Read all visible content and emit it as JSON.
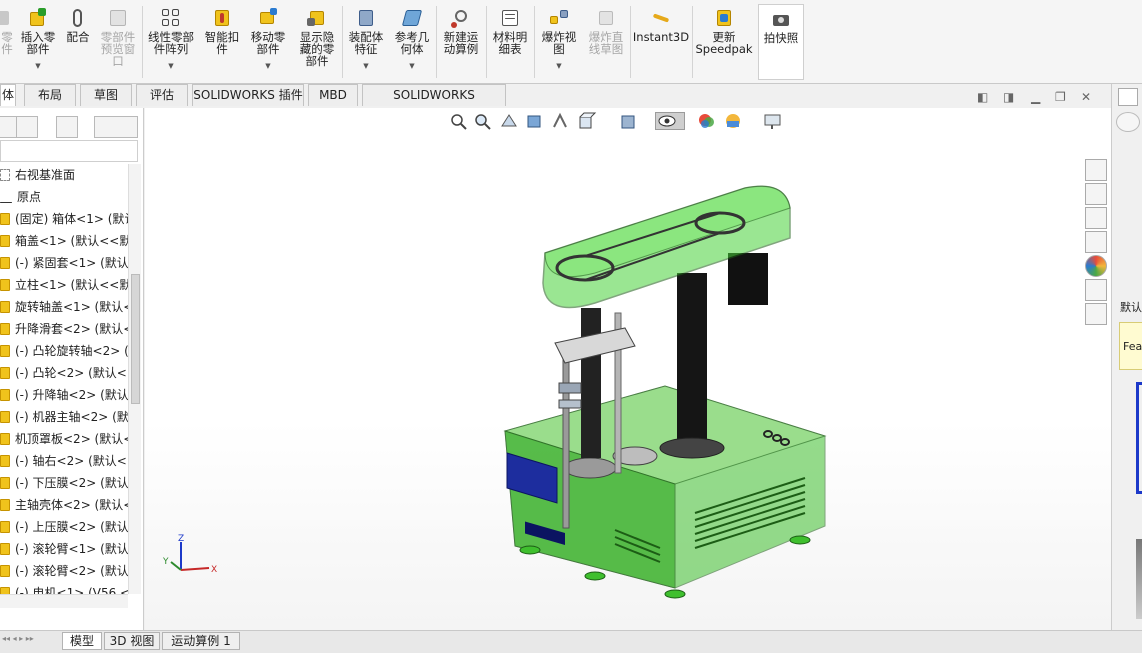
{
  "ribbon": {
    "items": [
      {
        "label": "零\n件",
        "disabled": true
      },
      {
        "label": "插入零\n部件",
        "dropdown": true
      },
      {
        "label": "配合"
      },
      {
        "label": "零部件\n预览窗\n口",
        "disabled": true
      },
      {
        "label": "线性零部\n件阵列",
        "dropdown": true
      },
      {
        "label": "智能扣\n件"
      },
      {
        "label": "移动零\n部件",
        "dropdown": true
      },
      {
        "label": "显示隐\n藏的零\n部件"
      },
      {
        "label": "装配体\n特征",
        "dropdown": true
      },
      {
        "label": "参考几\n何体",
        "dropdown": true
      },
      {
        "label": "新建运\n动算例"
      },
      {
        "label": "材料明\n细表"
      },
      {
        "label": "爆炸视\n图",
        "dropdown": true
      },
      {
        "label": "爆炸直\n线草图",
        "disabled": true
      },
      {
        "label": "Instant3D"
      },
      {
        "label": "更新\nSpeedpak"
      },
      {
        "label": "拍快照"
      }
    ]
  },
  "command_tabs": [
    "体",
    "布局",
    "草图",
    "评估",
    "SOLIDWORKS 插件",
    "MBD",
    "SOLIDWORKS Inspection"
  ],
  "tree": {
    "items": [
      {
        "label": "右视基准面",
        "type": "plane"
      },
      {
        "label": "原点",
        "type": "origin"
      },
      {
        "label": "(固定) 箱体<1> (默认<",
        "type": "part"
      },
      {
        "label": "箱盖<1> (默认<<默认",
        "type": "part"
      },
      {
        "label": "(-) 紧固套<1> (默认<",
        "type": "part"
      },
      {
        "label": "立柱<1> (默认<<默认",
        "type": "part"
      },
      {
        "label": "旋转轴盖<1> (默认<",
        "type": "part"
      },
      {
        "label": "升降滑套<2> (默认<",
        "type": "part"
      },
      {
        "label": "(-) 凸轮旋转轴<2> (",
        "type": "part"
      },
      {
        "label": "(-) 凸轮<2> (默认<",
        "type": "part"
      },
      {
        "label": "(-) 升降轴<2> (默认<",
        "type": "part"
      },
      {
        "label": "(-) 机器主轴<2> (默",
        "type": "part"
      },
      {
        "label": "机顶罩板<2> (默认<",
        "type": "part"
      },
      {
        "label": "(-) 轴右<2> (默认<",
        "type": "part"
      },
      {
        "label": "(-) 下压膜<2> (默认",
        "type": "part"
      },
      {
        "label": "主轴壳体<2> (默认<",
        "type": "part"
      },
      {
        "label": "(-) 上压膜<2> (默认",
        "type": "part"
      },
      {
        "label": "(-) 滚轮臂<1> (默认",
        "type": "part"
      },
      {
        "label": "(-) 滚轮臂<2> (默认",
        "type": "part"
      },
      {
        "label": "(-) 电机<1> (V56 <",
        "type": "part"
      }
    ]
  },
  "bottom_tabs": [
    "模型",
    "3D 视图",
    "运动算例 1"
  ],
  "triad": {
    "x": "X",
    "y": "Y",
    "z": "Z"
  },
  "task_pane": {
    "label1": "默认",
    "label2": "Fea"
  },
  "colors": {
    "accent": "#1c69c6",
    "housing_green": "#3fbf2e",
    "dark_panel": "#1d2d9e"
  }
}
